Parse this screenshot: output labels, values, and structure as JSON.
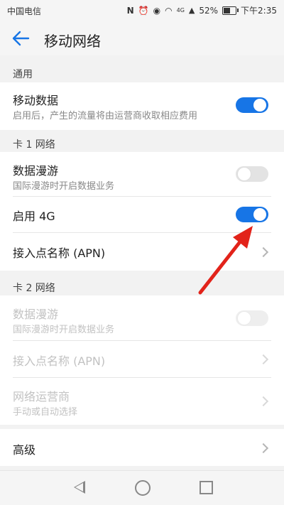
{
  "status_bar": {
    "carrier": "中国电信",
    "network": "4G",
    "battery": "52%",
    "time": "下午2:35"
  },
  "header": {
    "title": "移动网络"
  },
  "sections": {
    "general": {
      "label": "通用",
      "mobile_data": {
        "title": "移动数据",
        "subtitle": "启用后，产生的流量将由运营商收取相应费用",
        "enabled": true
      }
    },
    "card1": {
      "label": "卡 1 网络",
      "roaming": {
        "title": "数据漫游",
        "subtitle": "国际漫游时开启数据业务",
        "enabled": false
      },
      "enable_4g": {
        "title": "启用 4G",
        "enabled": true
      },
      "apn": {
        "title": "接入点名称 (APN)"
      }
    },
    "card2": {
      "label": "卡 2 网络",
      "roaming": {
        "title": "数据漫游",
        "subtitle": "国际漫游时开启数据业务",
        "enabled": false
      },
      "apn": {
        "title": "接入点名称 (APN)"
      },
      "operator": {
        "title": "网络运营商",
        "subtitle": "手动或自动选择"
      }
    },
    "advanced": {
      "title": "高级"
    }
  },
  "colors": {
    "accent": "#1775e6",
    "annotation_arrow": "#e2231a"
  }
}
